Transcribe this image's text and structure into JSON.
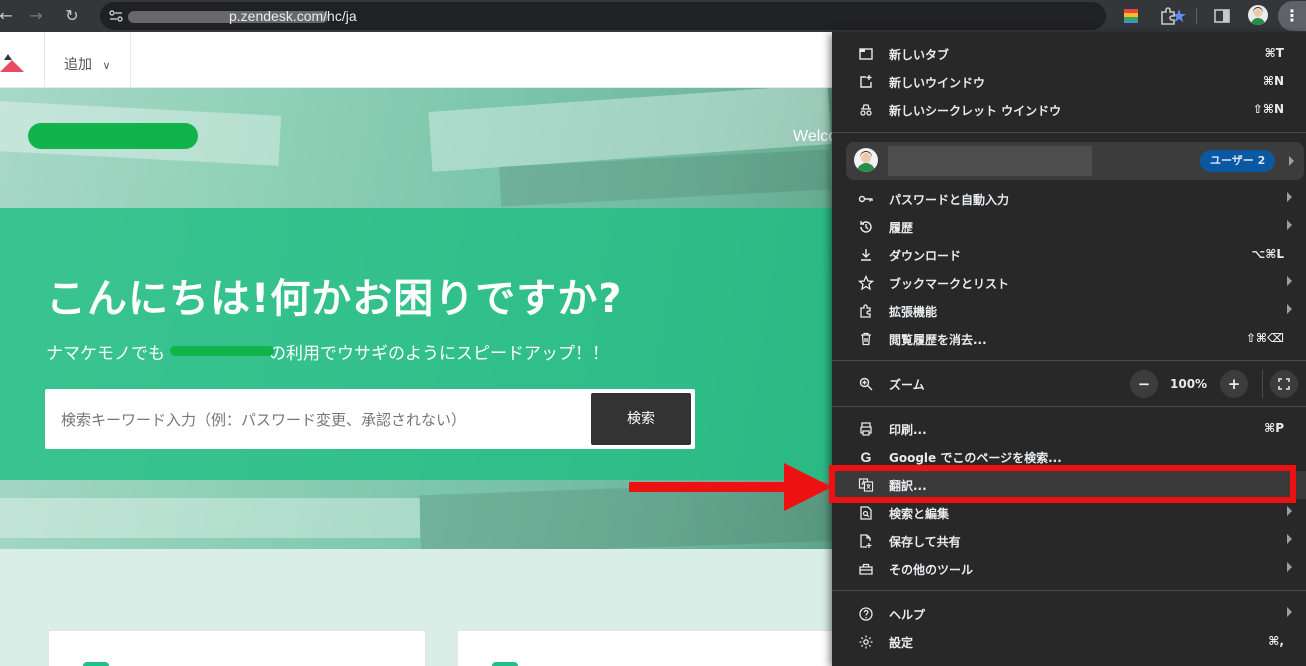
{
  "browser": {
    "url": "p.zendesk.com/hc/ja",
    "nav_back": "←",
    "nav_forward": "→",
    "nav_reload": "↻",
    "kebab": "⋮"
  },
  "site": {
    "add_menu_label": "追加",
    "welcome_text": "Welco",
    "hero_title": "こんにちは!何かお困りですか?",
    "hero_subtitle_prefix": "ナマケモノでも",
    "hero_subtitle_suffix": "の利用でウサギのようにスピードアップ！！",
    "search_placeholder": "検索キーワード入力（例：パスワード変更、承認されない）",
    "search_button": "検索"
  },
  "menu": {
    "items": [
      {
        "label": "新しいタブ",
        "shortcut": "⌘T",
        "icon": "new-tab-icon"
      },
      {
        "label": "新しいウインドウ",
        "shortcut": "⌘N",
        "icon": "new-window-icon"
      },
      {
        "label": "新しいシークレット ウインドウ",
        "shortcut": "⇧⌘N",
        "icon": "incognito-icon"
      }
    ],
    "profile": {
      "badge": "ユーザー 2"
    },
    "items2": [
      {
        "label": "パスワードと自動入力",
        "icon": "key-icon"
      },
      {
        "label": "履歴",
        "icon": "history-icon"
      },
      {
        "label": "ダウンロード",
        "shortcut": "⌥⌘L",
        "icon": "download-icon"
      },
      {
        "label": "ブックマークとリスト",
        "icon": "star-icon"
      },
      {
        "label": "拡張機能",
        "icon": "extension-icon"
      },
      {
        "label": "閲覧履歴を消去...",
        "shortcut": "⇧⌘⌫",
        "icon": "trash-icon"
      }
    ],
    "zoom": {
      "label": "ズーム",
      "value": "100%",
      "minus": "−",
      "plus": "+"
    },
    "items3": [
      {
        "label": "印刷...",
        "shortcut": "⌘P",
        "icon": "print-icon"
      },
      {
        "label": "Google でこのページを検索...",
        "icon": "google-icon"
      },
      {
        "label": "翻訳...",
        "icon": "translate-icon"
      },
      {
        "label": "検索と編集",
        "icon": "find-icon"
      },
      {
        "label": "保存して共有",
        "icon": "save-share-icon"
      },
      {
        "label": "その他のツール",
        "icon": "toolbox-icon"
      }
    ],
    "items4": [
      {
        "label": "ヘルプ",
        "icon": "help-icon"
      },
      {
        "label": "設定",
        "shortcut": "⌘,",
        "icon": "gear-icon"
      }
    ]
  },
  "colors": {
    "annotation": "#ee1111",
    "menu_bg": "#282828",
    "hero_accent": "#1cbe82"
  }
}
